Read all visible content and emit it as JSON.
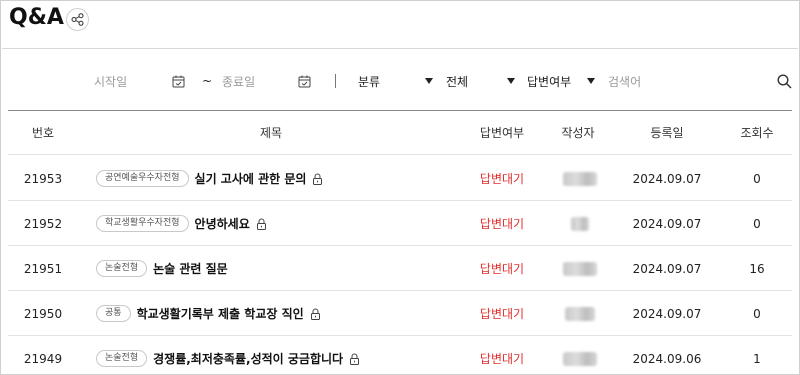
{
  "header": {
    "title": "Q&A",
    "share_icon": "share-icon"
  },
  "filters": {
    "start_date_placeholder": "시작일",
    "date_separator": "~",
    "end_date_placeholder": "종료일",
    "calendar_icon": "calendar-icon",
    "category_label": "분류",
    "category_value": "전체",
    "answer_status_label": "답변여부",
    "search_placeholder": "검색어",
    "search_icon": "search-icon"
  },
  "table": {
    "columns": [
      "번호",
      "제목",
      "답변여부",
      "작성자",
      "등록일",
      "조회수"
    ],
    "rows": [
      {
        "no": "21953",
        "category": "공연예술우수자전형",
        "title": "실기 고사에 관한 문의",
        "locked": true,
        "status": "답변대기",
        "date": "2024.09.07",
        "views": "0"
      },
      {
        "no": "21952",
        "category": "학교생활우수자전형",
        "title": "안녕하세요",
        "locked": true,
        "status": "답변대기",
        "date": "2024.09.07",
        "views": "0"
      },
      {
        "no": "21951",
        "category": "논술전형",
        "title": "논술 관련 질문",
        "locked": false,
        "status": "답변대기",
        "date": "2024.09.07",
        "views": "16"
      },
      {
        "no": "21950",
        "category": "공통",
        "title": "학교생활기록부 제출 학교장 직인",
        "locked": true,
        "status": "답변대기",
        "date": "2024.09.07",
        "views": "0"
      },
      {
        "no": "21949",
        "category": "논술전형",
        "title": "경쟁률,최저충족률,성적이 궁금합니다",
        "locked": true,
        "status": "답변대기",
        "date": "2024.09.06",
        "views": "1"
      }
    ]
  },
  "colors": {
    "status_pending": "#e0302f",
    "border": "#d8d8d8"
  }
}
